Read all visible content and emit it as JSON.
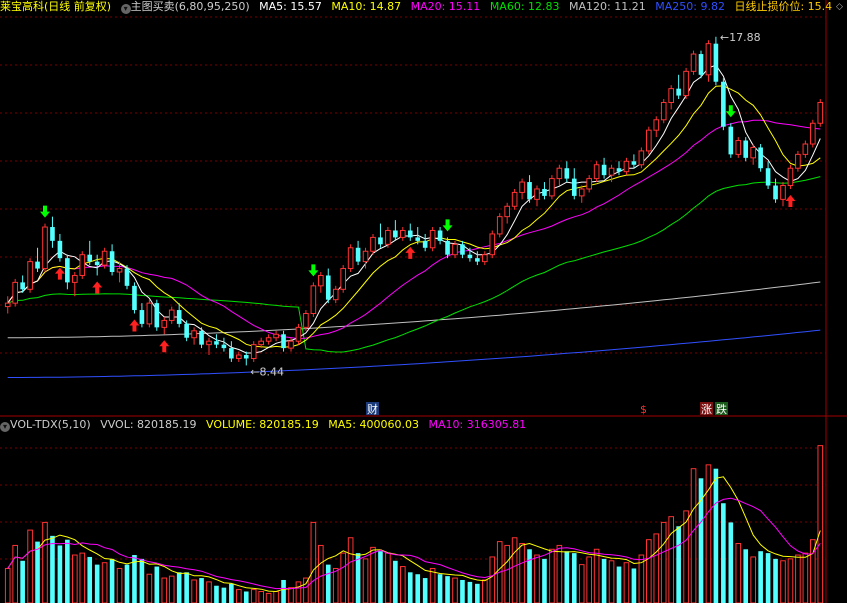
{
  "header": {
    "stock_name": "莱宝高科",
    "period": "(日线 前复权)",
    "indicator_name": "主图买卖(6,80,95,250)",
    "ma5": "MA5: 15.57",
    "ma10": "MA10: 14.87",
    "ma20": "MA20: 15.11",
    "ma60": "MA60: 12.83",
    "ma120": "MA120: 11.21",
    "ma250": "MA250: 9.82",
    "stop_loss": "日线止损价位: 15.4"
  },
  "vol_header": {
    "name": "VOL-TDX(5,10)",
    "vvol": "VVOL: 820185.19",
    "volume": "VOLUME: 820185.19",
    "ma5": "MA5: 400060.03",
    "ma10": "MA10: 316305.81"
  },
  "annotations": {
    "high_label": "17.88",
    "low_label": "8.44",
    "event_cai": "财",
    "event_s": "$",
    "event_zhang": "涨",
    "event_die": "跌"
  },
  "colors": {
    "up": "#ff3333",
    "down": "#54ffff",
    "ma5": "#ffffff",
    "ma10": "#ffff00",
    "ma20": "#ff00ff",
    "ma60": "#00e000",
    "ma120": "#c0c0c0",
    "ma250": "#3050ff",
    "grid": "#7a0000",
    "buy_arrow": "#ff2020",
    "sell_arrow": "#00ff00"
  },
  "chart_data": {
    "type": "candlestick",
    "price_range": [
      7.8,
      18.9
    ],
    "volume_range": [
      0,
      860000
    ],
    "candles": [
      [
        10.5,
        10.8,
        10.3,
        10.6,
        180000
      ],
      [
        10.6,
        11.3,
        10.5,
        11.2,
        300000
      ],
      [
        11.2,
        11.4,
        10.9,
        11.0,
        220000
      ],
      [
        11.0,
        11.9,
        10.9,
        11.8,
        380000
      ],
      [
        11.8,
        12.2,
        11.5,
        11.6,
        320000
      ],
      [
        11.6,
        12.9,
        11.5,
        12.8,
        420000
      ],
      [
        12.8,
        13.1,
        12.2,
        12.4,
        350000
      ],
      [
        12.4,
        12.6,
        11.8,
        11.9,
        300000
      ],
      [
        11.9,
        12.0,
        11.0,
        11.2,
        330000
      ],
      [
        11.2,
        11.5,
        10.8,
        11.4,
        250000
      ],
      [
        11.4,
        12.1,
        11.3,
        12.0,
        260000
      ],
      [
        12.0,
        12.4,
        11.7,
        11.8,
        240000
      ],
      [
        11.8,
        12.0,
        11.4,
        11.7,
        200000
      ],
      [
        11.7,
        12.2,
        11.6,
        12.1,
        210000
      ],
      [
        12.1,
        12.3,
        11.4,
        11.5,
        230000
      ],
      [
        11.5,
        11.8,
        11.2,
        11.6,
        180000
      ],
      [
        11.6,
        11.7,
        11.0,
        11.1,
        200000
      ],
      [
        11.1,
        11.2,
        10.3,
        10.4,
        250000
      ],
      [
        10.4,
        10.6,
        9.9,
        10.0,
        230000
      ],
      [
        10.0,
        10.7,
        9.9,
        10.6,
        150000
      ],
      [
        10.6,
        10.7,
        9.8,
        9.9,
        190000
      ],
      [
        9.9,
        10.2,
        9.7,
        10.1,
        130000
      ],
      [
        10.1,
        10.5,
        10.0,
        10.4,
        140000
      ],
      [
        10.4,
        10.6,
        9.9,
        10.0,
        160000
      ],
      [
        10.0,
        10.1,
        9.5,
        9.6,
        160000
      ],
      [
        9.6,
        9.9,
        9.4,
        9.8,
        120000
      ],
      [
        9.8,
        9.9,
        9.3,
        9.4,
        130000
      ],
      [
        9.4,
        9.6,
        9.1,
        9.5,
        110000
      ],
      [
        9.5,
        9.7,
        9.3,
        9.4,
        90000
      ],
      [
        9.4,
        9.6,
        9.2,
        9.3,
        80000
      ],
      [
        9.3,
        9.5,
        8.9,
        9.0,
        100000
      ],
      [
        9.0,
        9.2,
        8.9,
        9.1,
        70000
      ],
      [
        9.1,
        9.2,
        8.8,
        9.0,
        60000
      ],
      [
        9.0,
        9.5,
        8.9,
        9.4,
        70000
      ],
      [
        9.4,
        9.6,
        9.3,
        9.5,
        60000
      ],
      [
        9.5,
        9.7,
        9.4,
        9.6,
        50000
      ],
      [
        9.6,
        9.8,
        9.5,
        9.7,
        60000
      ],
      [
        9.7,
        9.8,
        9.2,
        9.3,
        120000
      ],
      [
        9.3,
        9.6,
        9.2,
        9.5,
        80000
      ],
      [
        9.5,
        10.0,
        9.4,
        9.9,
        110000
      ],
      [
        9.9,
        10.4,
        9.8,
        10.3,
        130000
      ],
      [
        10.3,
        11.2,
        10.2,
        11.1,
        420000
      ],
      [
        11.1,
        11.5,
        10.9,
        11.4,
        300000
      ],
      [
        11.4,
        11.6,
        10.6,
        10.7,
        200000
      ],
      [
        10.7,
        11.1,
        10.6,
        11.0,
        180000
      ],
      [
        11.0,
        11.7,
        10.9,
        11.6,
        260000
      ],
      [
        11.6,
        12.3,
        11.5,
        12.2,
        340000
      ],
      [
        12.2,
        12.4,
        11.7,
        11.8,
        260000
      ],
      [
        11.8,
        12.2,
        11.6,
        12.1,
        230000
      ],
      [
        12.1,
        12.6,
        12.0,
        12.5,
        290000
      ],
      [
        12.5,
        12.9,
        12.2,
        12.3,
        270000
      ],
      [
        12.3,
        12.8,
        12.2,
        12.7,
        260000
      ],
      [
        12.7,
        13.0,
        12.4,
        12.5,
        220000
      ],
      [
        12.5,
        12.8,
        12.4,
        12.7,
        190000
      ],
      [
        12.7,
        12.9,
        12.4,
        12.5,
        160000
      ],
      [
        12.5,
        12.8,
        12.3,
        12.4,
        150000
      ],
      [
        12.4,
        12.6,
        12.1,
        12.2,
        130000
      ],
      [
        12.2,
        12.8,
        12.1,
        12.7,
        180000
      ],
      [
        12.7,
        12.8,
        12.3,
        12.4,
        150000
      ],
      [
        12.4,
        12.5,
        11.9,
        12.0,
        140000
      ],
      [
        12.0,
        12.4,
        11.9,
        12.3,
        130000
      ],
      [
        12.3,
        12.4,
        11.9,
        12.0,
        120000
      ],
      [
        12.0,
        12.2,
        11.8,
        11.9,
        110000
      ],
      [
        11.9,
        12.1,
        11.7,
        11.8,
        100000
      ],
      [
        11.8,
        12.1,
        11.7,
        12.0,
        120000
      ],
      [
        12.0,
        12.7,
        11.9,
        12.6,
        240000
      ],
      [
        12.6,
        13.2,
        12.5,
        13.1,
        320000
      ],
      [
        13.1,
        13.5,
        12.9,
        13.4,
        300000
      ],
      [
        13.4,
        13.9,
        13.3,
        13.8,
        340000
      ],
      [
        13.8,
        14.2,
        13.6,
        14.1,
        310000
      ],
      [
        14.1,
        14.3,
        13.5,
        13.6,
        280000
      ],
      [
        13.6,
        14.0,
        13.4,
        13.9,
        250000
      ],
      [
        13.9,
        14.1,
        13.6,
        13.7,
        230000
      ],
      [
        13.7,
        14.3,
        13.6,
        14.2,
        280000
      ],
      [
        14.2,
        14.6,
        14.0,
        14.5,
        300000
      ],
      [
        14.5,
        14.7,
        14.1,
        14.2,
        270000
      ],
      [
        14.2,
        14.5,
        13.6,
        13.7,
        260000
      ],
      [
        13.7,
        14.0,
        13.5,
        13.9,
        200000
      ],
      [
        13.9,
        14.3,
        13.8,
        14.2,
        240000
      ],
      [
        14.2,
        14.7,
        14.1,
        14.6,
        280000
      ],
      [
        14.6,
        14.8,
        14.2,
        14.3,
        230000
      ],
      [
        14.3,
        14.6,
        14.1,
        14.5,
        220000
      ],
      [
        14.5,
        14.7,
        14.3,
        14.4,
        190000
      ],
      [
        14.4,
        14.8,
        14.3,
        14.7,
        210000
      ],
      [
        14.7,
        14.9,
        14.5,
        14.6,
        180000
      ],
      [
        14.6,
        15.1,
        14.5,
        15.0,
        250000
      ],
      [
        15.0,
        15.7,
        14.9,
        15.6,
        330000
      ],
      [
        15.6,
        16.0,
        15.4,
        15.9,
        360000
      ],
      [
        15.9,
        16.5,
        15.8,
        16.4,
        420000
      ],
      [
        16.4,
        16.9,
        16.2,
        16.8,
        450000
      ],
      [
        16.8,
        17.2,
        16.5,
        16.6,
        400000
      ],
      [
        16.6,
        17.4,
        16.5,
        17.3,
        480000
      ],
      [
        17.3,
        17.9,
        17.2,
        17.8,
        700000
      ],
      [
        17.8,
        17.9,
        17.1,
        17.2,
        650000
      ],
      [
        17.2,
        18.2,
        17.0,
        18.1,
        720000
      ],
      [
        18.1,
        18.3,
        16.9,
        17.0,
        700000
      ],
      [
        17.0,
        17.1,
        15.6,
        15.7,
        520000
      ],
      [
        15.7,
        15.8,
        14.8,
        14.9,
        420000
      ],
      [
        14.9,
        15.4,
        14.8,
        15.3,
        310000
      ],
      [
        15.3,
        15.4,
        14.7,
        14.8,
        280000
      ],
      [
        14.8,
        15.2,
        14.6,
        15.1,
        240000
      ],
      [
        15.1,
        15.2,
        14.4,
        14.5,
        270000
      ],
      [
        14.5,
        14.7,
        13.9,
        14.0,
        260000
      ],
      [
        14.0,
        14.2,
        13.5,
        13.6,
        230000
      ],
      [
        13.6,
        14.1,
        13.4,
        14.0,
        220000
      ],
      [
        14.0,
        14.6,
        13.9,
        14.5,
        230000
      ],
      [
        14.5,
        15.0,
        14.4,
        14.9,
        250000
      ],
      [
        14.9,
        15.3,
        14.8,
        15.2,
        260000
      ],
      [
        15.2,
        15.9,
        15.1,
        15.8,
        330000
      ],
      [
        15.8,
        16.5,
        15.7,
        16.4,
        820185
      ]
    ],
    "buy_signal_indices": [
      7,
      12,
      17,
      21,
      54,
      105
    ],
    "sell_signal_indices": [
      5,
      41,
      59,
      97
    ],
    "labels": {
      "high": "17.88",
      "low": "8.44"
    }
  }
}
